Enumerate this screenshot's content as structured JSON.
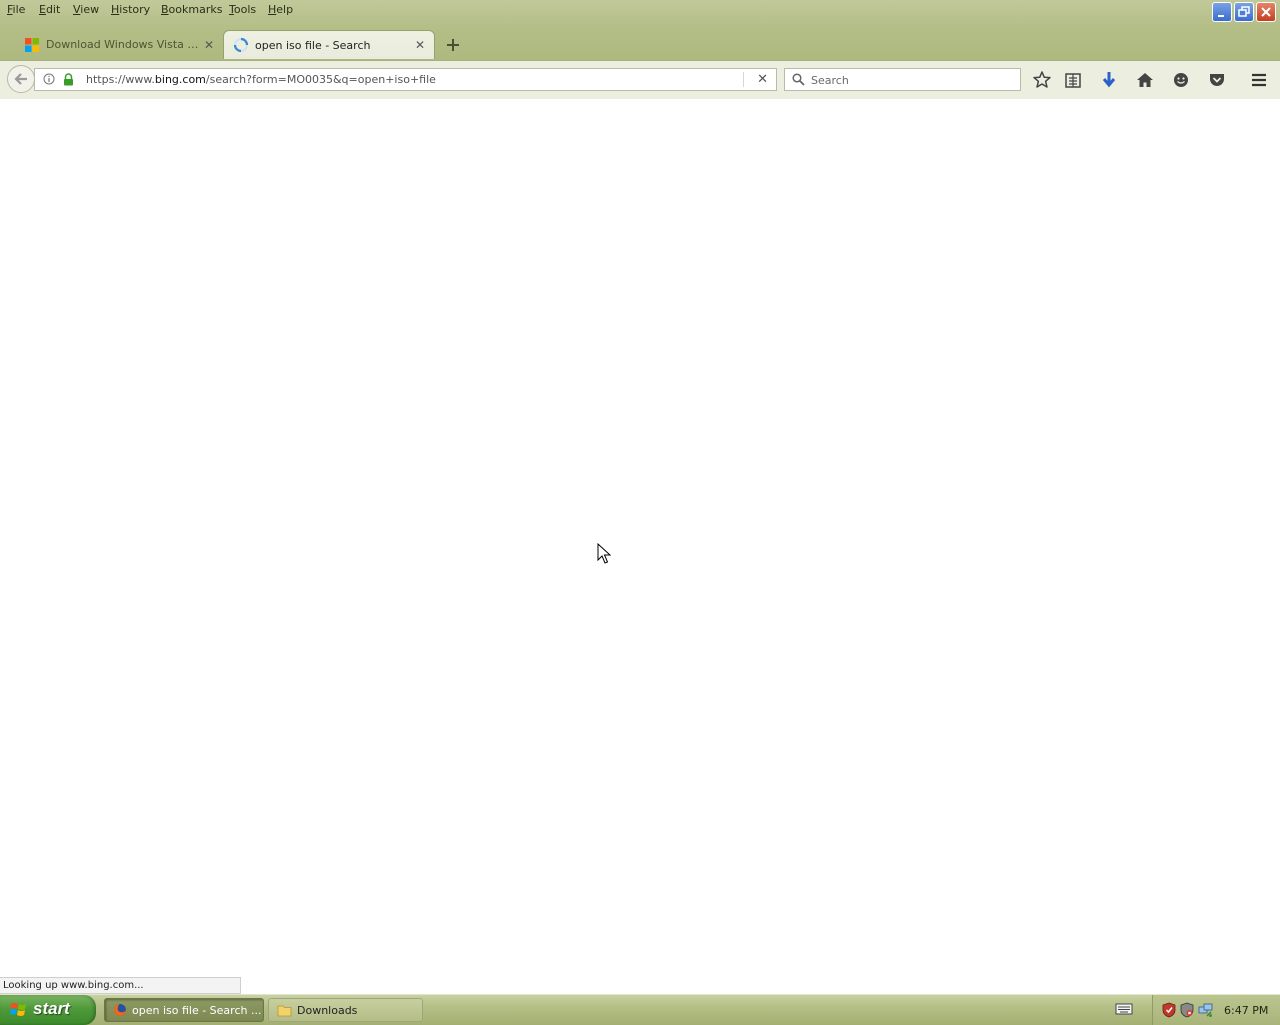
{
  "menu": [
    "File",
    "Edit",
    "View",
    "History",
    "Bookmarks",
    "Tools",
    "Help"
  ],
  "tabs": [
    {
      "title": "Download Windows Vista Ser...",
      "favicon": "microsoft-logo-icon",
      "active": false
    },
    {
      "title": "open iso file - Search",
      "favicon": "loading-spinner-icon",
      "active": true
    }
  ],
  "url": {
    "prefix": "https://www.",
    "host": "bing.com",
    "path": "/search?form=MO0035&q=open+iso+file"
  },
  "search": {
    "placeholder": "Search"
  },
  "toolbar_icons": [
    "bookmark-star-icon",
    "reading-list-icon",
    "downloads-arrow-icon",
    "home-icon",
    "hello-icon",
    "pocket-icon",
    "menu-hamburger-icon"
  ],
  "status_text": "Looking up www.bing.com...",
  "taskbar": {
    "start_label": "start",
    "buttons": [
      {
        "label": "open iso file - Search ...",
        "icon": "firefox-icon",
        "active": true
      },
      {
        "label": "Downloads",
        "icon": "folder-icon",
        "active": false
      }
    ],
    "clock": "6:47 PM"
  },
  "colors": {
    "chrome": "#b3bd86",
    "taskbar": "#b4bf86",
    "start": "#4f9a3a"
  }
}
